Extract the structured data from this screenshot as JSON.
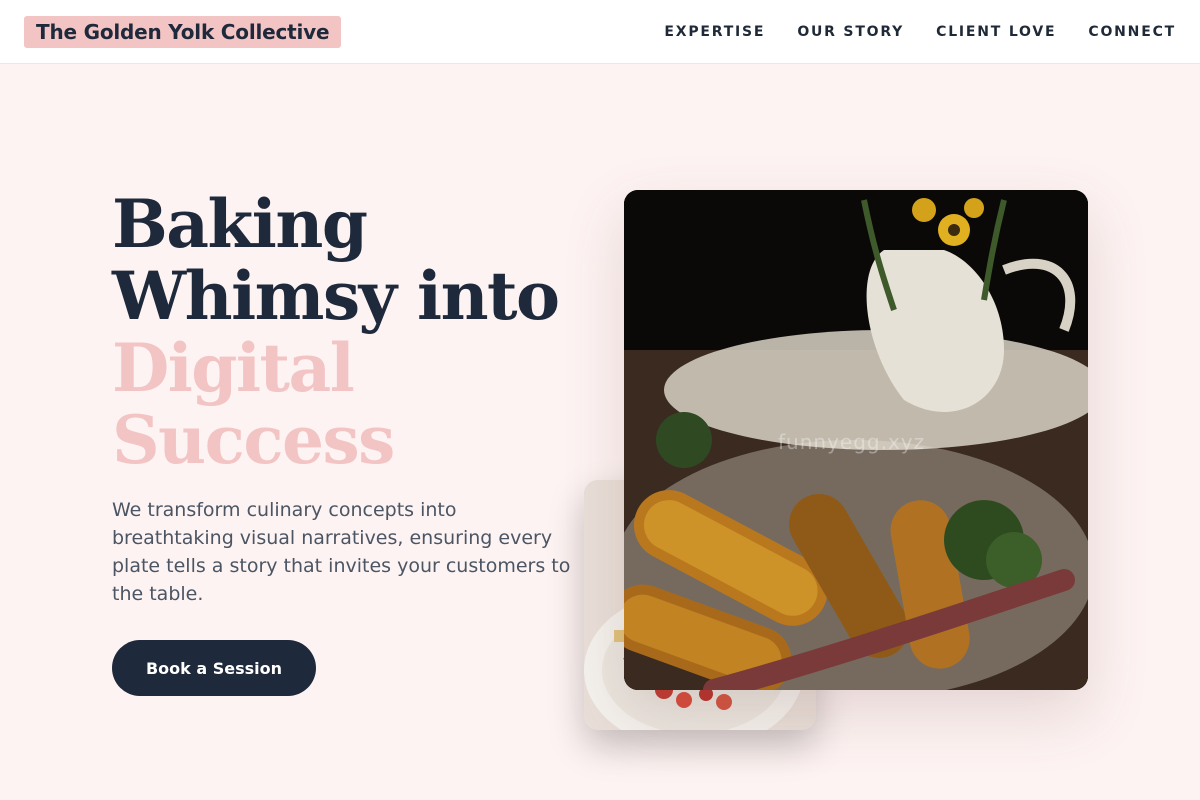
{
  "brand": {
    "name": "The Golden Yolk Collective"
  },
  "nav": {
    "items": [
      "EXPERTISE",
      "OUR STORY",
      "CLIENT LOVE",
      "CONNECT"
    ]
  },
  "hero": {
    "headline_dark": [
      "Baking",
      "Whimsy into"
    ],
    "headline_accent": [
      "Digital",
      "Success"
    ],
    "description": "We transform culinary concepts into breathtaking visual narratives, ensuring every plate tells a story that invites your customers to the table.",
    "cta_label": "Book a Session"
  },
  "images": {
    "main_photo": "roasted-corn-food-photo",
    "secondary_photo": "salad-plate-food-photo",
    "watermark": "funnyegg.xyz"
  },
  "colors": {
    "accent": "#f3c4c4",
    "primary": "#1e293b",
    "background": "#fdf3f2"
  }
}
